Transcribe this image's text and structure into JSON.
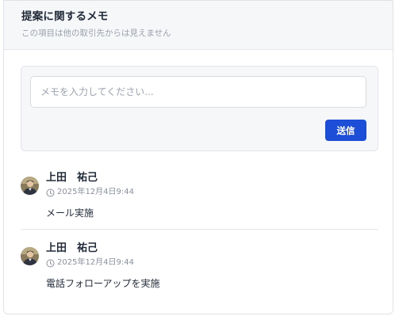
{
  "panel": {
    "title": "提案に関するメモ",
    "subtitle": "この項目は他の取引先からは見えません"
  },
  "composer": {
    "placeholder": "メモを入力してください...",
    "send_label": "送信"
  },
  "colors": {
    "accent": "#1d4ed8",
    "header_bg": "#f6f7f9",
    "border": "#e3e6ea"
  },
  "memos": [
    {
      "author": "上田　祐己",
      "timestamp": "2025年12月4日9:44",
      "text": "メール実施",
      "icons": [
        "avatar",
        "clock-icon"
      ]
    },
    {
      "author": "上田　祐己",
      "timestamp": "2025年12月4日9:44",
      "text": "電話フォローアップを実施",
      "icons": [
        "avatar",
        "clock-icon"
      ]
    }
  ]
}
